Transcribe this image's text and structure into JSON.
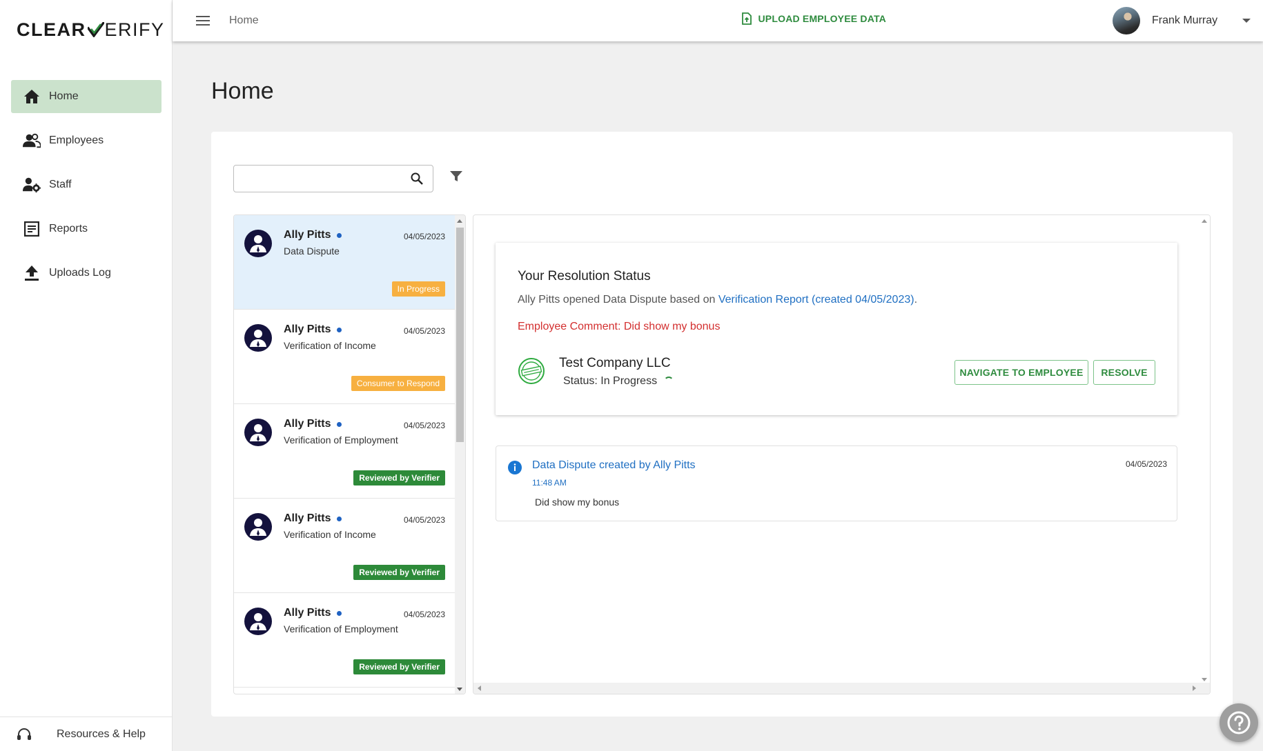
{
  "brand": {
    "part1": "CLEAR",
    "part2": "ERIFY",
    "check_color": "#2e8b3e"
  },
  "sidebar": {
    "items": [
      {
        "label": "Home",
        "icon": "home-icon",
        "active": true
      },
      {
        "label": "Employees",
        "icon": "people-icon",
        "active": false
      },
      {
        "label": "Staff",
        "icon": "staff-settings-icon",
        "active": false
      },
      {
        "label": "Reports",
        "icon": "report-icon",
        "active": false
      },
      {
        "label": "Uploads Log",
        "icon": "upload-icon",
        "active": false
      }
    ],
    "footer_label": "Resources & Help"
  },
  "topbar": {
    "breadcrumb": "Home",
    "upload_label": "UPLOAD EMPLOYEE DATA",
    "user_name": "Frank Murray"
  },
  "page": {
    "title": "Home"
  },
  "search": {
    "placeholder": "",
    "value": ""
  },
  "tickets": [
    {
      "name": "Ally Pitts",
      "date": "04/05/2023",
      "type": "Data Dispute",
      "status": "In Progress",
      "status_color": "orange",
      "selected": true
    },
    {
      "name": "Ally Pitts",
      "date": "04/05/2023",
      "type": "Verification of Income",
      "status": "Consumer to Respond",
      "status_color": "orange",
      "selected": false
    },
    {
      "name": "Ally Pitts",
      "date": "04/05/2023",
      "type": "Verification of Employment",
      "status": "Reviewed by Verifier",
      "status_color": "green",
      "selected": false
    },
    {
      "name": "Ally Pitts",
      "date": "04/05/2023",
      "type": "Verification of Income",
      "status": "Reviewed by Verifier",
      "status_color": "green",
      "selected": false
    },
    {
      "name": "Ally Pitts",
      "date": "04/05/2023",
      "type": "Verification of Employment",
      "status": "Reviewed by Verifier",
      "status_color": "green",
      "selected": false
    }
  ],
  "resolution": {
    "title": "Your Resolution Status",
    "line_prefix": "Ally Pitts opened Data Dispute based on ",
    "line_link": "Verification Report (created 04/05/2023)",
    "line_suffix": ".",
    "comment": "Employee Comment: Did show my bonus",
    "company_name": "Test Company LLC",
    "company_status": "Status: In Progress",
    "navigate_label": "NAVIGATE TO EMPLOYEE",
    "resolve_label": "RESOLVE"
  },
  "timeline": {
    "title": "Data Dispute created by Ally Pitts",
    "time": "11:48 AM",
    "date": "04/05/2023",
    "body": "Did show my bonus"
  },
  "colors": {
    "accent_green": "#2e8b3e",
    "link_blue": "#1f6fc2",
    "comment_red": "#d32f2f",
    "badge_orange": "#f7b040",
    "badge_green": "#2d8a39",
    "nav_active": "#cbe2cc"
  }
}
